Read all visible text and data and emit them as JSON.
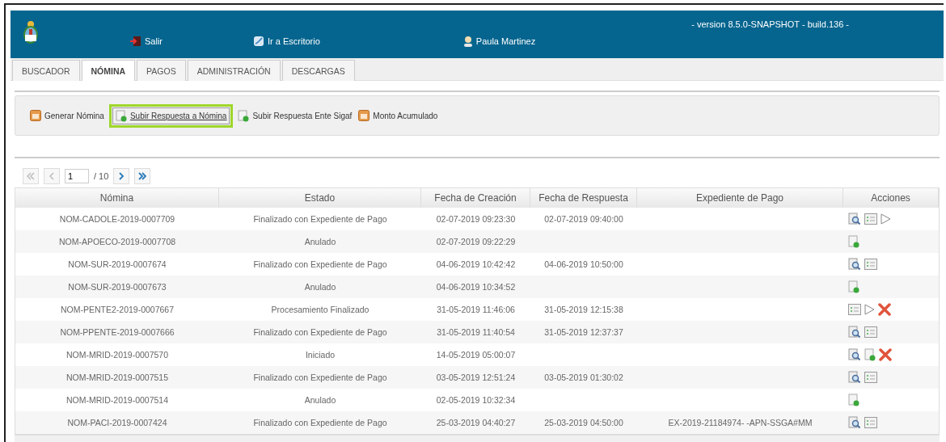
{
  "header": {
    "links": [
      {
        "kind": "exit",
        "label": "Salir"
      },
      {
        "kind": "desktop",
        "label": "Ir a Escritorio"
      },
      {
        "kind": "user",
        "label": "Paula Martinez"
      }
    ],
    "version": "- version 8.5.0-SNAPSHOT - build.136 -"
  },
  "tabs": [
    {
      "label": "BUSCADOR",
      "selected": false
    },
    {
      "label": "NÓMINA",
      "selected": true
    },
    {
      "label": "PAGOS",
      "selected": false
    },
    {
      "label": "ADMINISTRACIÓN",
      "selected": false
    },
    {
      "label": "DESCARGAS",
      "selected": false
    }
  ],
  "toolbar": [
    {
      "kind": "ledger",
      "label": "Generar Nómina",
      "selected": false
    },
    {
      "kind": "upload",
      "label": "Subir Respuesta a Nómina",
      "selected": true
    },
    {
      "kind": "upload",
      "label": "Subir Respuesta Ente Sigaf",
      "selected": false
    },
    {
      "kind": "ledger",
      "label": "Monto Acumulado",
      "selected": false
    }
  ],
  "pagination": {
    "page": "1",
    "total": "/ 10"
  },
  "table": {
    "columns": [
      "Nómina",
      "Estado",
      "Fecha de Creación",
      "Fecha de Respuesta",
      "Expediente de Pago",
      "Acciones"
    ],
    "rows": [
      {
        "cells": [
          "NOM-CADOLE-2019-0007709",
          "Finalizado con Expediente de Pago",
          "02-07-2019 09:23:30",
          "02-07-2019 09:40:00",
          ""
        ],
        "actions": [
          {
            "kind": "view"
          },
          {
            "kind": "list"
          },
          {
            "kind": "play"
          }
        ]
      },
      {
        "cells": [
          "NOM-APOECO-2019-0007708",
          "Anulado",
          "02-07-2019 09:22:29",
          "",
          ""
        ],
        "actions": [
          {
            "kind": "upload"
          }
        ]
      },
      {
        "cells": [
          "NOM-SUR-2019-0007674",
          "Finalizado con Expediente de Pago",
          "04-06-2019 10:42:42",
          "04-06-2019 10:50:00",
          ""
        ],
        "actions": [
          {
            "kind": "view"
          },
          {
            "kind": "list"
          }
        ]
      },
      {
        "cells": [
          "NOM-SUR-2019-0007673",
          "Anulado",
          "04-06-2019 10:34:52",
          "",
          ""
        ],
        "actions": [
          {
            "kind": "upload"
          }
        ]
      },
      {
        "cells": [
          "NOM-PENTE2-2019-0007667",
          "Procesamiento Finalizado",
          "31-05-2019 11:46:06",
          "31-05-2019 12:15:38",
          ""
        ],
        "actions": [
          {
            "kind": "list"
          },
          {
            "kind": "play"
          },
          {
            "kind": "delete"
          }
        ]
      },
      {
        "cells": [
          "NOM-PPENTE-2019-0007666",
          "Finalizado con Expediente de Pago",
          "31-05-2019 11:40:54",
          "31-05-2019 12:37:37",
          ""
        ],
        "actions": [
          {
            "kind": "view"
          },
          {
            "kind": "list"
          }
        ]
      },
      {
        "cells": [
          "NOM-MRID-2019-0007570",
          "Iniciado",
          "14-05-2019 05:00:07",
          "",
          ""
        ],
        "actions": [
          {
            "kind": "view"
          },
          {
            "kind": "upload"
          },
          {
            "kind": "delete"
          }
        ]
      },
      {
        "cells": [
          "NOM-MRID-2019-0007515",
          "Finalizado con Expediente de Pago",
          "03-05-2019 12:51:24",
          "03-05-2019 01:30:02",
          ""
        ],
        "actions": [
          {
            "kind": "view"
          },
          {
            "kind": "list"
          }
        ]
      },
      {
        "cells": [
          "NOM-MRID-2019-0007514",
          "Anulado",
          "02-05-2019 10:32:34",
          "",
          ""
        ],
        "actions": [
          {
            "kind": "upload"
          }
        ]
      },
      {
        "cells": [
          "NOM-PACI-2019-0007424",
          "Finalizado con Expediente de Pago",
          "25-03-2019 04:40:27",
          "25-03-2019 04:50:00",
          "EX-2019-21184974- -APN-SSGA#MM"
        ],
        "actions": [
          {
            "kind": "view"
          },
          {
            "kind": "list"
          }
        ]
      }
    ]
  }
}
